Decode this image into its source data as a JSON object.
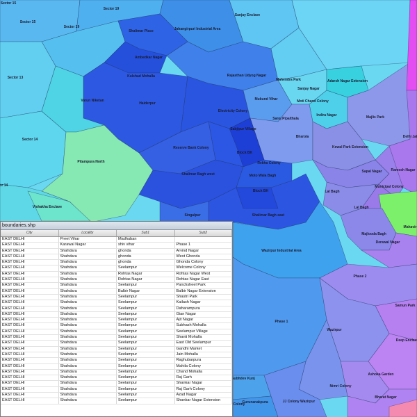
{
  "colors": {
    "cyan": "#6ad8f0",
    "blue": "#2b5be0",
    "deep_blue": "#1e3fd8",
    "teal": "#3ec3d9",
    "green": "#66e6a6",
    "violet": "#a58ee6",
    "purple": "#c080ee",
    "magenta": "#e04ef0",
    "lime": "#7cf06a"
  },
  "map": {
    "labels": [
      "Sector 15",
      "Sector 15",
      "Sector 19",
      "Sector 19",
      "Sector 13",
      "Sector 14",
      "Shalimar Place",
      "Jahangirpuri Industrial Area",
      "Sanjay Enclave",
      "Ambedkar Nagar",
      "Kulshad Mohalla",
      "Varun Niketan",
      "Haiderpur",
      "Rajasthan Udyog Nagar",
      "Mahendra Park",
      "Sanjay Nagar",
      "Adarsh Nagar Extension",
      "Mukund Vihar",
      "Moti Chand Colony",
      "Electricity Colony",
      "Indira Nagar",
      "Majlis Park",
      "Saroj Pipalthala",
      "Sabjipur Village",
      "Bharola",
      "Kewal Park Extension",
      "Reserve Bank Colony",
      "Pitampura North",
      "Block BK",
      "Rekha Colony",
      "Delhi Jal",
      "Shalimar Bagh west",
      "Moto Wala Bagh",
      "Sapal Nagar",
      "Ramesh Nagar",
      "Municipal Colony",
      "Block BH",
      "Lal Bagh",
      "Sector 14",
      "Vishakha Enclave",
      "Singalpur",
      "Shalimar Bagh east",
      "Lal Bagh",
      "Majlooda Bagh",
      "Mahavir",
      "Derawal Nagar",
      "Wazirpur Industrial Area",
      "Phase 2",
      "Samun Park",
      "Phase 1",
      "Wazirpur",
      "Deep Enclave",
      "Ashoka Garden",
      "Subhdev Kunj",
      "Nimri Colony",
      "Bharat Nagar",
      "Gurunanakpura",
      "JJ Colony Wazirpur",
      "Colony"
    ]
  },
  "table": {
    "title": "boundaries.shp",
    "columns": [
      "City",
      "Locality",
      "Sub1",
      "Sub2"
    ],
    "rows": [
      [
        "EAST DELHI",
        "Preet Vihar",
        "Madhuban",
        ""
      ],
      [
        "EAST DELHI",
        "Karawal Nagar",
        "shiv vihar",
        "Phase 1"
      ],
      [
        "EAST DELHI",
        "Shahdara",
        "ghonda",
        "Arvind Nagar"
      ],
      [
        "EAST DELHI",
        "Shahdara",
        "ghonda",
        "West Ghonda"
      ],
      [
        "EAST DELHI",
        "Shahdara",
        "ghonda",
        "Ghonda Colony"
      ],
      [
        "EAST DELHI",
        "Shahdara",
        "Seelampur",
        "Welcome Colony"
      ],
      [
        "EAST DELHI",
        "Shahdara",
        "Rohtas Nagar",
        "Rohtas Nagar West"
      ],
      [
        "EAST DELHI",
        "Shahdara",
        "Rohtas Nagar",
        "Rohtas Nagar East"
      ],
      [
        "EAST DELHI",
        "Shahdara",
        "Seelampur",
        "Panchsheel Park"
      ],
      [
        "EAST DELHI",
        "Shahdara",
        "Balbir Nagar",
        "Balbir Nagar Extension"
      ],
      [
        "EAST DELHI",
        "Shahdara",
        "Seelampur",
        "Shastri Park"
      ],
      [
        "EAST DELHI",
        "Shahdara",
        "Seelampur",
        "Kailash Nagar"
      ],
      [
        "EAST DELHI",
        "Shahdara",
        "Seelampur",
        "Daharampura"
      ],
      [
        "EAST DELHI",
        "Shahdara",
        "Seelampur",
        "Gian Nagar"
      ],
      [
        "EAST DELHI",
        "Shahdara",
        "Seelampur",
        "Ajit Nagar"
      ],
      [
        "EAST DELHI",
        "Shahdara",
        "Seelampur",
        "Subhash Mohalla"
      ],
      [
        "EAST DELHI",
        "Shahdara",
        "Seelampur",
        "Seelampur Village"
      ],
      [
        "EAST DELHI",
        "Shahdara",
        "Seelampur",
        "Shanti Mohalla"
      ],
      [
        "EAST DELHI",
        "Shahdara",
        "Seelampur",
        "East Old Seelampur"
      ],
      [
        "EAST DELHI",
        "Shahdara",
        "Seelampur",
        "Gandhi Market"
      ],
      [
        "EAST DELHI",
        "Shahdara",
        "Seelampur",
        "Jain Mohalla"
      ],
      [
        "EAST DELHI",
        "Shahdara",
        "Seelampur",
        "Raghubarpura"
      ],
      [
        "EAST DELHI",
        "Shahdara",
        "Seelampur",
        "Mahila Colony"
      ],
      [
        "EAST DELHI",
        "Shahdara",
        "Seelampur",
        "Chand Mohalla"
      ],
      [
        "EAST DELHI",
        "Shahdara",
        "Seelampur",
        "Raj Garh"
      ],
      [
        "EAST DELHI",
        "Shahdara",
        "Seelampur",
        "Shankar Nagar"
      ],
      [
        "EAST DELHI",
        "Shahdara",
        "Seelampur",
        "Raj Garh Colony"
      ],
      [
        "EAST DELHI",
        "Shahdara",
        "Seelampur",
        "Azad Nagar"
      ],
      [
        "EAST DELHI",
        "Shahdara",
        "Seelampur",
        "Shankar Nagar Extension"
      ]
    ]
  }
}
